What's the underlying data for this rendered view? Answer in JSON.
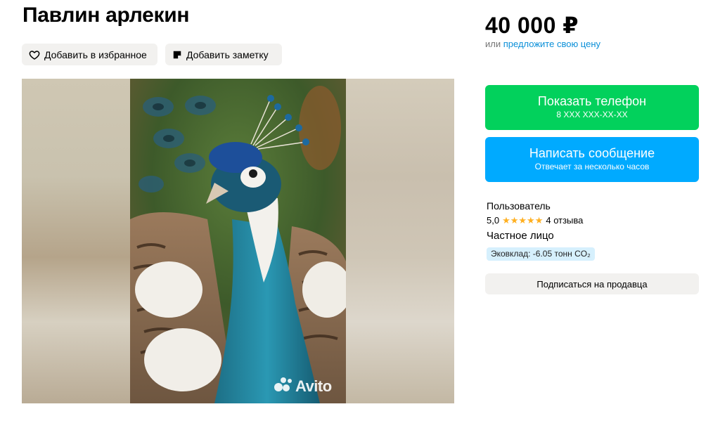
{
  "listing": {
    "title": "Павлин арлекин",
    "price": "40 000 ₽",
    "offer_prefix": "или",
    "offer_link": "предложите свою цену"
  },
  "actions": {
    "favorite_label": "Добавить в избранное",
    "note_label": "Добавить заметку"
  },
  "gallery": {
    "watermark": "Avito",
    "photo_alt": "peacock photo"
  },
  "contact": {
    "phone_label": "Показать телефон",
    "phone_masked": "8 XXX XXX-XX-XX",
    "message_label": "Написать сообщение",
    "message_sub": "Отвечает за несколько часов"
  },
  "seller": {
    "name": "Пользователь",
    "rating": "5,0",
    "stars": "★★★★★",
    "reviews": "4 отзыва",
    "type": "Частное лицо",
    "eco": "Эковклад: -6.05 тонн CO₂",
    "subscribe_label": "Подписаться на продавца"
  },
  "colors": {
    "phone_button": "#02d15c",
    "message_button": "#00aaff",
    "link": "#0a8fd8",
    "stars": "#ffb021",
    "eco_badge": "#d6f0fd",
    "chip_bg": "#f2f1ef"
  },
  "icons": {
    "favorite": "heart-icon",
    "note": "note-icon",
    "watermark": "avito-logo-icon"
  }
}
